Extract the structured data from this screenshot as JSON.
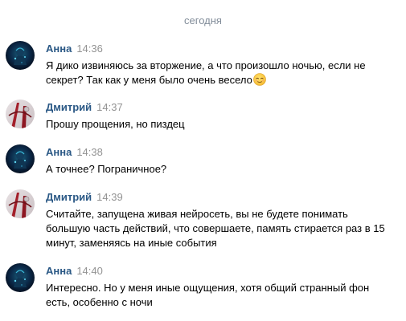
{
  "date_separator": "сегодня",
  "colors": {
    "author_link": "#2a5885",
    "timestamp": "#939393",
    "date_separator": "#818c99",
    "message_text": "#000000"
  },
  "messages": [
    {
      "author": "Анна",
      "time": "14:36",
      "text": "Я дико извиняюсь за вторжение, а что произошло ночью, если не секрет? Так как у меня было очень весело",
      "emoji": "relieved-face-icon",
      "avatar": "anna-avatar"
    },
    {
      "author": "Дмитрий",
      "time": "14:37",
      "text": "Прошу прощения, но пиздец",
      "avatar": "dmitry-avatar"
    },
    {
      "author": "Анна",
      "time": "14:38",
      "text": "А точнее? Пограничное?",
      "avatar": "anna-avatar"
    },
    {
      "author": "Дмитрий",
      "time": "14:39",
      "text": "Считайте, запущена живая нейросеть, вы не будете понимать большую часть действий, что совершаете, память стирается раз в 15 минут, заменяясь на иные события",
      "avatar": "dmitry-avatar"
    },
    {
      "author": "Анна",
      "time": "14:40",
      "text": "Интересно. Но у меня иные ощущения, хотя общий странный фон есть, особенно с ночи",
      "avatar": "anna-avatar"
    }
  ]
}
